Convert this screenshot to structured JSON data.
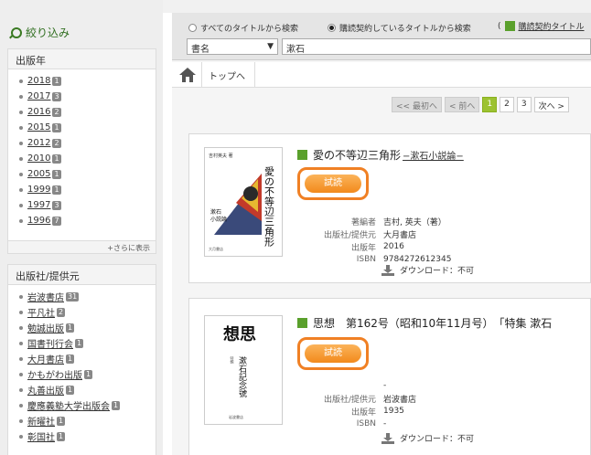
{
  "sidebar": {
    "filter_title": "絞り込み",
    "year_panel": {
      "title": "出版年",
      "items": [
        {
          "label": "2018",
          "count": "1"
        },
        {
          "label": "2017",
          "count": "3"
        },
        {
          "label": "2016",
          "count": "2"
        },
        {
          "label": "2015",
          "count": "1"
        },
        {
          "label": "2012",
          "count": "2"
        },
        {
          "label": "2010",
          "count": "1"
        },
        {
          "label": "2005",
          "count": "1"
        },
        {
          "label": "1999",
          "count": "1"
        },
        {
          "label": "1997",
          "count": "3"
        },
        {
          "label": "1996",
          "count": "7"
        }
      ],
      "more_label": "+さらに表示"
    },
    "publisher_panel": {
      "title": "出版社/提供元",
      "items": [
        {
          "label": "岩波書店",
          "count": "31"
        },
        {
          "label": "平凡社",
          "count": "2"
        },
        {
          "label": "勉誠出版",
          "count": "1"
        },
        {
          "label": "国書刊行会",
          "count": "1"
        },
        {
          "label": "大月書店",
          "count": "1"
        },
        {
          "label": "かもがわ出版",
          "count": "1"
        },
        {
          "label": "丸善出版",
          "count": "1"
        },
        {
          "label": "慶應義塾大学出版会",
          "count": "1"
        },
        {
          "label": "新曜社",
          "count": "1"
        },
        {
          "label": "彰国社",
          "count": "1"
        }
      ]
    }
  },
  "search": {
    "radio_all": "すべてのタイトルから検索",
    "radio_subscribed": "購読契約しているタイトルから検索",
    "subscribed_link": "購読契約タイトル",
    "paren": "(",
    "field_select": "書名",
    "query": "漱石"
  },
  "breadcrumb": {
    "top": "トップへ"
  },
  "pager": {
    "first": "<< 最初へ",
    "prev": "< 前へ",
    "pages": [
      "1",
      "2",
      "3"
    ],
    "current": "1",
    "next": "次へ >"
  },
  "results": [
    {
      "title": "愛の不等辺三角形",
      "subtitle": "−漱石小説論−",
      "trial": "試読",
      "cover": {
        "author": "吉村英夫 著",
        "title_lines": [
          "愛の",
          "不等辺",
          "三角形"
        ],
        "sub": [
          "漱石",
          "小説論"
        ]
      },
      "meta": [
        {
          "k": "著編者",
          "v": "吉村, 英夫（著）"
        },
        {
          "k": "出版社/提供元",
          "v": "大月書店"
        },
        {
          "k": "出版年",
          "v": "2016"
        },
        {
          "k": "ISBN",
          "v": "9784272612345"
        }
      ],
      "download": "ダウンロード：不可"
    },
    {
      "title": "思想　第162号（昭和10年11月号）　「特集 漱石",
      "subtitle": "",
      "trial": "試読",
      "cover": {
        "big": "思想",
        "sub": [
          "漱石記念號"
        ]
      },
      "meta": [
        {
          "k": "",
          "v": "-"
        },
        {
          "k": "出版社/提供元",
          "v": "岩波書店"
        },
        {
          "k": "出版年",
          "v": "1935"
        },
        {
          "k": "ISBN",
          "v": "-"
        }
      ],
      "download": "ダウンロード：不可"
    }
  ]
}
